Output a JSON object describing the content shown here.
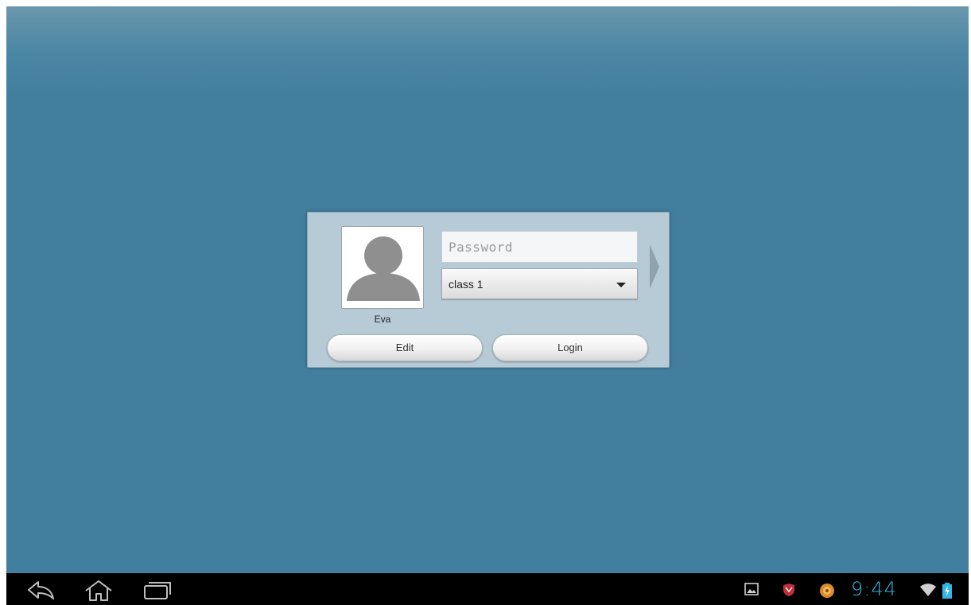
{
  "login": {
    "user_name": "Eva",
    "password_placeholder": "Password",
    "password_value": "",
    "class_selected": "class 1",
    "edit_label": "Edit",
    "login_label": "Login"
  },
  "status_bar": {
    "time": "9:44",
    "icons": [
      "gallery-icon",
      "security-shield-icon",
      "app-notification-icon",
      "wifi-icon",
      "battery-charging-icon"
    ]
  },
  "nav_bar": {
    "buttons": [
      "back-icon",
      "home-icon",
      "recent-apps-icon"
    ]
  },
  "colors": {
    "background": "#427f9f",
    "panel": "#b7cbd6",
    "clock": "#33b5e5"
  }
}
